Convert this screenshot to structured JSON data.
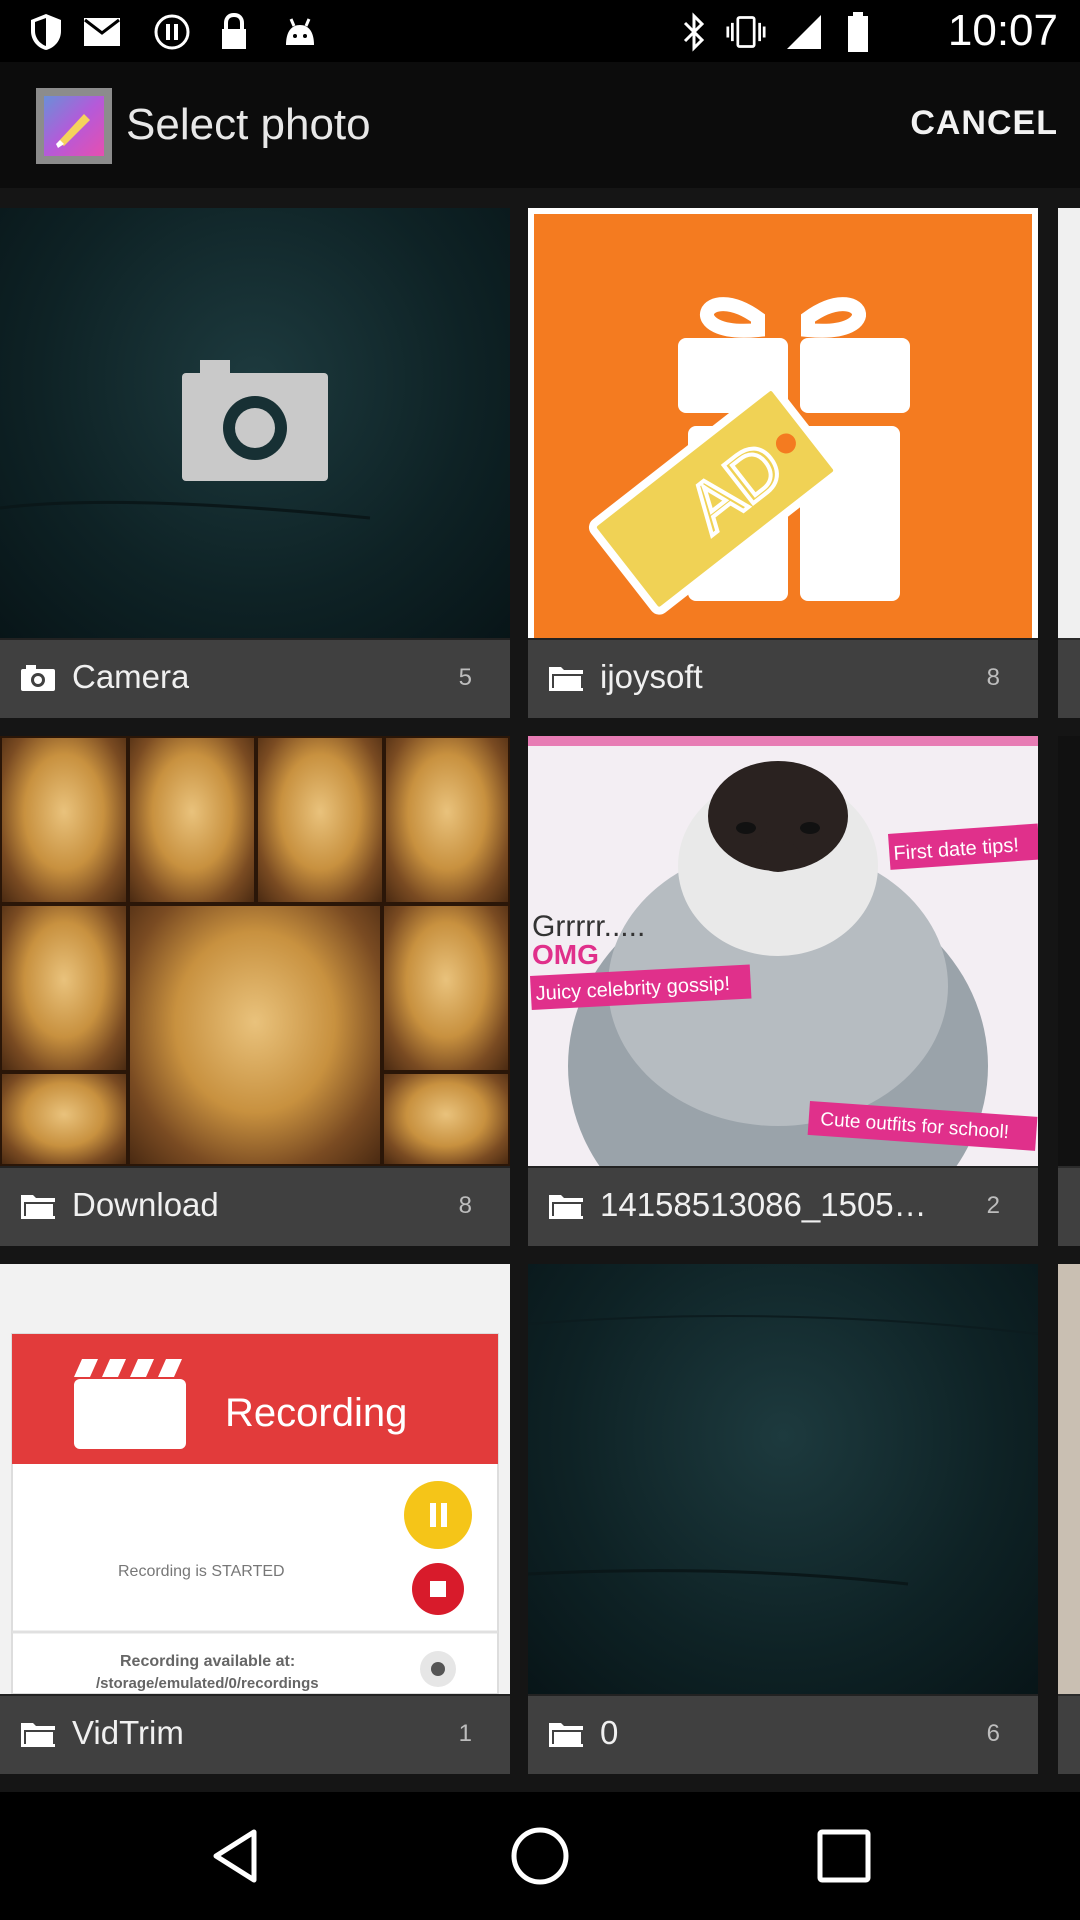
{
  "status_bar": {
    "time": "10:07",
    "left_icons": [
      "shield-icon",
      "mail-icon",
      "pause-circle-icon",
      "lock-icon",
      "android-icon"
    ],
    "right_icons": [
      "bluetooth-icon",
      "vibrate-icon",
      "signal-icon",
      "battery-icon"
    ]
  },
  "header": {
    "title": "Select photo",
    "cancel_label": "CANCEL"
  },
  "albums": [
    {
      "name": "Camera",
      "count": "5",
      "icon": "camera-icon"
    },
    {
      "name": "ijoysoft",
      "count": "8",
      "icon": "folder-icon"
    },
    {
      "name": "Download",
      "count": "8",
      "icon": "folder-icon"
    },
    {
      "name": "14158513086_15056...",
      "count": "2",
      "icon": "folder-icon"
    },
    {
      "name": "VidTrim",
      "count": "1",
      "icon": "folder-icon"
    },
    {
      "name": "0",
      "count": "6",
      "icon": "folder-icon"
    }
  ],
  "thumb_text": {
    "ad_tag": "AD",
    "penguin_grr": "Grrrrr.....",
    "penguin_omg": "OMG",
    "penguin_gossip": "Juicy celebrity gossip!",
    "penguin_date": "First date tips!",
    "penguin_outfits": "Cute outfits for school!",
    "recording_title": "Recording",
    "recording_started": "Recording is STARTED",
    "recording_available": "Recording available at:",
    "recording_path": "/storage/emulated/0/recordings"
  },
  "nav_bar": {
    "icons": [
      "back-icon",
      "home-icon",
      "recents-icon"
    ]
  },
  "colors": {
    "orange": "#f47b20",
    "recording_red": "#e23b3b",
    "pause_yellow": "#f5c518",
    "stop_red": "#d81b2b",
    "label_bar": "#404040"
  }
}
